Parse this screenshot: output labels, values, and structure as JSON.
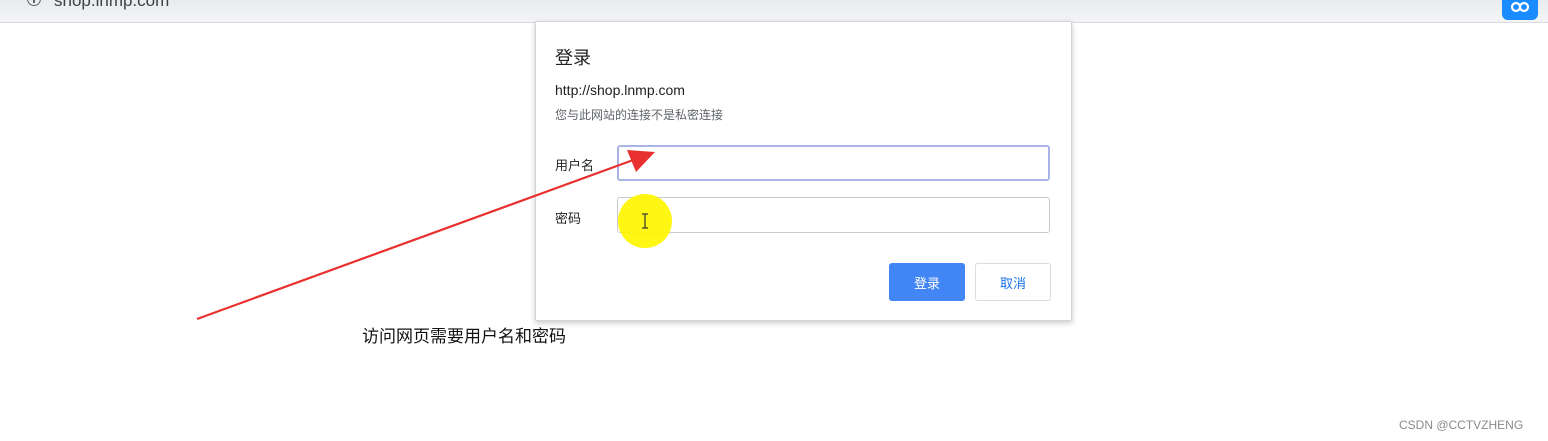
{
  "browser": {
    "url": "shop.lnmp.com",
    "info_icon": "info-icon",
    "extension_icon": "extension-icon"
  },
  "dialog": {
    "title": "登录",
    "site_url": "http://shop.lnmp.com",
    "warning": "您与此网站的连接不是私密连接",
    "username_label": "用户名",
    "username_value": "",
    "password_label": "密码",
    "password_value": "",
    "login_button": "登录",
    "cancel_button": "取消",
    "accent_color": "#4285f4"
  },
  "annotation": {
    "text": "访问网页需要用户名和密码",
    "arrow_color": "#e8312f",
    "highlight_color": "#fff500"
  },
  "watermark": "CSDN @CCTVZHENG"
}
